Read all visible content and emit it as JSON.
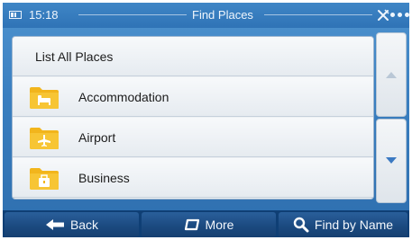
{
  "status_bar": {
    "time": "15:18",
    "title": "Find Places",
    "battery_icon": "battery-icon",
    "gps_icon": "satellite-off-icon",
    "menu_icon": "more-dots-icon"
  },
  "list": {
    "items": [
      {
        "label": "List All Places",
        "icon": null
      },
      {
        "label": "Accommodation",
        "icon": "bed-folder-icon"
      },
      {
        "label": "Airport",
        "icon": "airplane-folder-icon"
      },
      {
        "label": "Business",
        "icon": "briefcase-folder-icon"
      }
    ]
  },
  "scroll": {
    "up_icon": "arrow-up-icon",
    "down_icon": "arrow-down-icon",
    "up_enabled": false,
    "down_enabled": true
  },
  "toolbar": {
    "back_label": "Back",
    "more_label": "More",
    "find_by_name_label": "Find by Name"
  },
  "colors": {
    "background_blue": "#3a7fc0",
    "toolbar_navy": "#0f3f75",
    "folder_yellow": "#f2b51c",
    "scroll_arrow_active": "#3b79c2",
    "scroll_arrow_disabled": "#b9c7d6"
  }
}
